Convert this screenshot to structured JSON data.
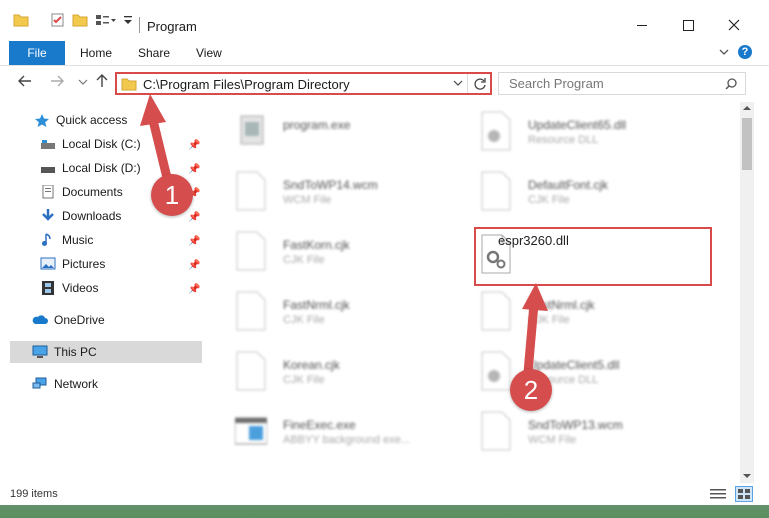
{
  "window": {
    "title": "Program"
  },
  "ribbon": {
    "tabs": [
      "File",
      "Home",
      "Share",
      "View"
    ]
  },
  "address": {
    "path": "C:\\Program Files\\Program Directory"
  },
  "search": {
    "placeholder": "Search Program"
  },
  "sidebar": {
    "quick_access": "Quick access",
    "items": [
      "Local Disk (C:)",
      "Local Disk (D:)",
      "Documents",
      "Downloads",
      "Music",
      "Pictures",
      "Videos"
    ],
    "onedrive": "OneDrive",
    "thispc": "This PC",
    "network": "Network"
  },
  "files": [
    {
      "name": "program.exe",
      "type": ""
    },
    {
      "name": "UpdateClient65.dll",
      "type": "Resource DLL"
    },
    {
      "name": "SndToWP14.wcm",
      "type": "WCM File"
    },
    {
      "name": "DefaultFont.cjk",
      "type": "CJK File"
    },
    {
      "name": "FastKorn.cjk",
      "type": "CJK File"
    },
    {
      "name": "espr3260.dll",
      "type": ""
    },
    {
      "name": "FastNrml.cjk",
      "type": "CJK File"
    },
    {
      "name": "FastNrml.cjk",
      "type": "CJK File"
    },
    {
      "name": "Korean.cjk",
      "type": "CJK File"
    },
    {
      "name": "UpdateClient5.dll",
      "type": "Resource DLL"
    },
    {
      "name": "FineExec.exe",
      "type": "ABBYY background exe..."
    },
    {
      "name": "SndToWP13.wcm",
      "type": "WCM File"
    }
  ],
  "status": {
    "items_count": "199 items"
  },
  "badges": {
    "one": "1",
    "two": "2"
  },
  "colors": {
    "accent": "#1979ca",
    "annotation": "#d94a4a"
  }
}
